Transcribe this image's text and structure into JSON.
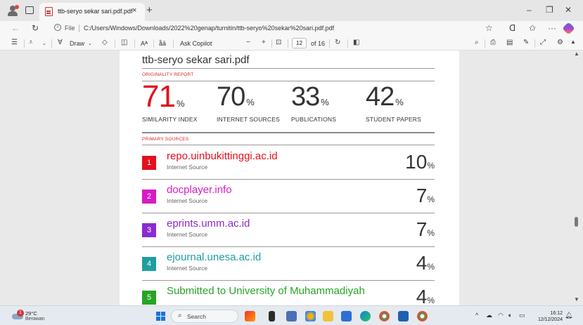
{
  "browser": {
    "tab_title": "ttb-seryo sekar sari.pdf.pdf",
    "tab_close": "×",
    "new_tab": "+",
    "window": {
      "minimize": "–",
      "restore": "❐",
      "close": "✕"
    },
    "address": {
      "file_label": "File",
      "url": "C:/Users/Windows/Downloads/2022%20genap/turnitin/ttb-seryo%20sekar%20sari.pdf.pdf"
    }
  },
  "pdf_toolbar": {
    "draw_label": "Draw",
    "ask_copilot_label": "Ask Copilot",
    "read_aloud_label": "Aᴬ",
    "page_current": "12",
    "page_total": "of 16",
    "zoom_out": "−",
    "zoom_in": "+"
  },
  "document": {
    "title": "ttb-seryo sekar sari.pdf",
    "originality_label": "ORIGINALITY REPORT",
    "stats": [
      {
        "value": "71",
        "unit": "%",
        "label": "SIMILARITY INDEX"
      },
      {
        "value": "70",
        "unit": "%",
        "label": "INTERNET SOURCES"
      },
      {
        "value": "33",
        "unit": "%",
        "label": "PUBLICATIONS"
      },
      {
        "value": "42",
        "unit": "%",
        "label": "STUDENT PAPERS"
      }
    ],
    "primary_sources_label": "PRIMARY SOURCES",
    "sources": [
      {
        "num": "1",
        "name": "repo.uinbukittinggi.ac.id",
        "type": "Internet Source",
        "value": "10",
        "unit": "%",
        "color": "#e3101d"
      },
      {
        "num": "2",
        "name": "docplayer.info",
        "type": "Internet Source",
        "value": "7",
        "unit": "%",
        "color": "#d71bc5"
      },
      {
        "num": "3",
        "name": "eprints.umm.ac.id",
        "type": "Internet Source",
        "value": "7",
        "unit": "%",
        "color": "#8a2bd0"
      },
      {
        "num": "4",
        "name": "ejournal.unesa.ac.id",
        "type": "Internet Source",
        "value": "4",
        "unit": "%",
        "color": "#1e9ea3"
      },
      {
        "num": "5",
        "name": "Submitted to University of Muhammadiyah",
        "type": "",
        "value": "4",
        "unit": "%",
        "color": "#27a527"
      }
    ]
  },
  "taskbar": {
    "weather_badge": "1",
    "temperature": "29°C",
    "condition": "Berawan",
    "search_placeholder": "Search",
    "time": "16:12",
    "date": "12/12/2024"
  }
}
